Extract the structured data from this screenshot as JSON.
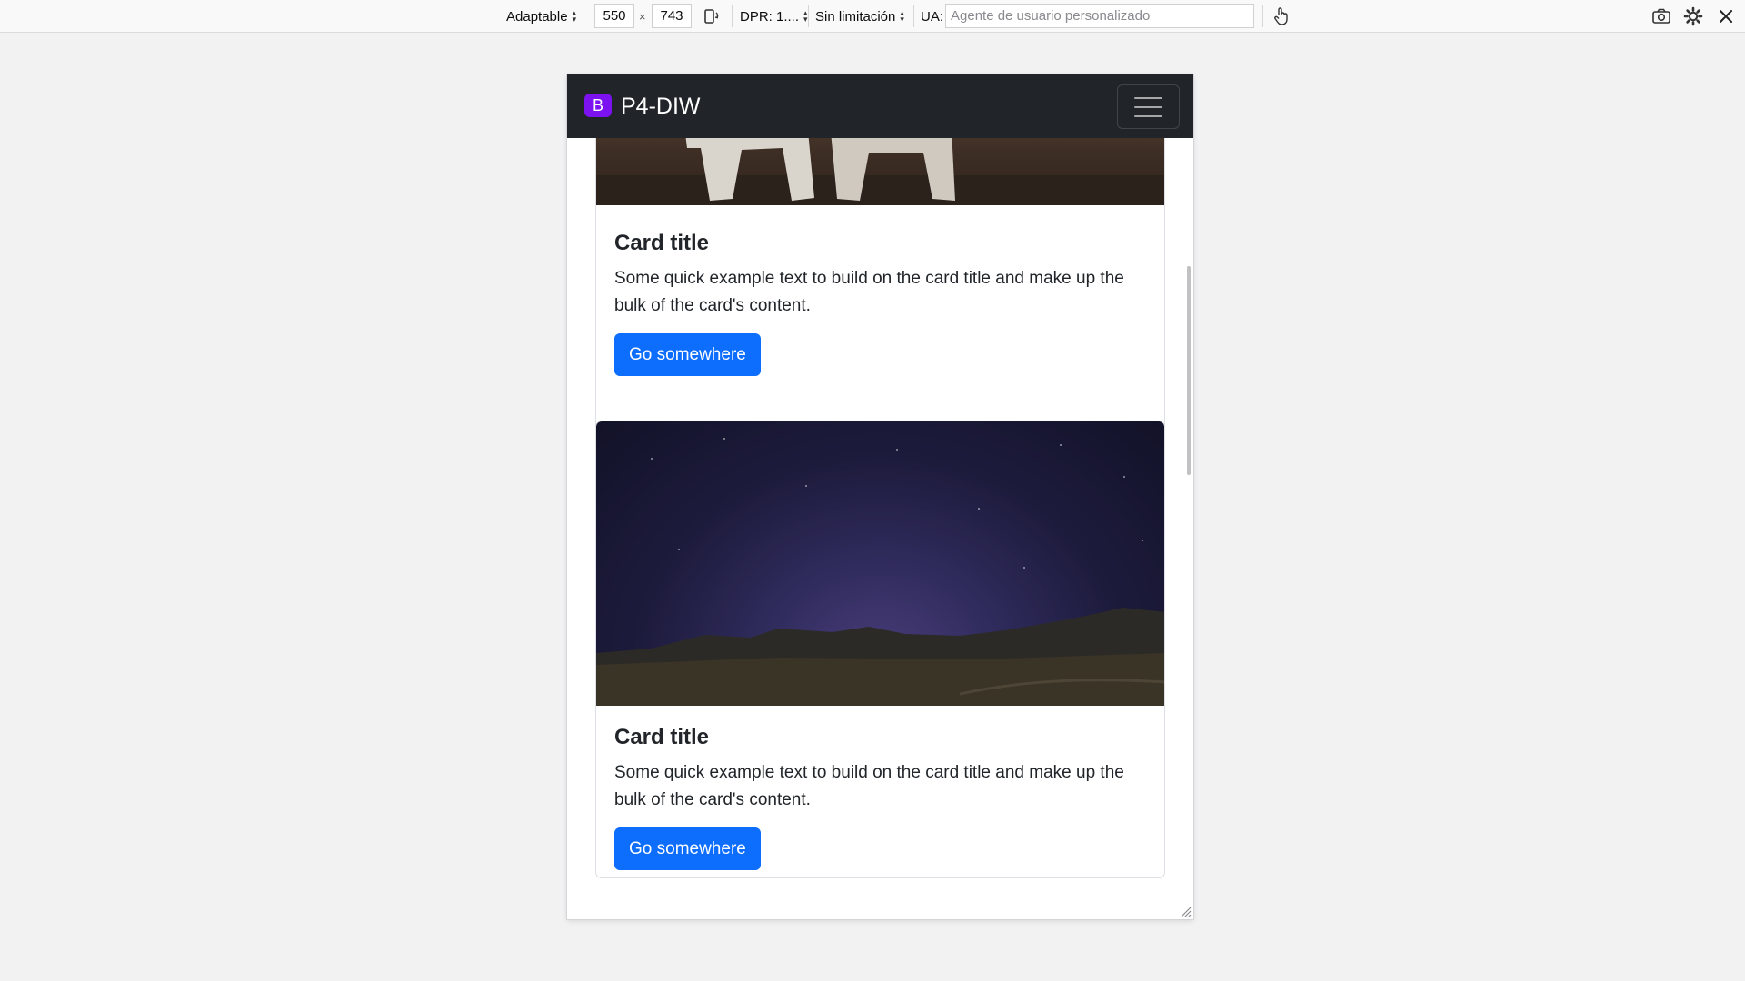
{
  "toolbar": {
    "device": "Adaptable",
    "width": "550",
    "times": "×",
    "height": "743",
    "dpr": "DPR: 1....",
    "throttling": "Sin limitación",
    "ua_label": "UA:",
    "ua_placeholder": "Agente de usuario personalizado",
    "icons": [
      "rotate-icon",
      "touch-icon",
      "screenshot-icon",
      "settings-icon",
      "close-icon"
    ]
  },
  "page": {
    "brand": {
      "logo_letter": "B",
      "title": "P4-DIW",
      "logo_color": "#7b12ef"
    },
    "cards": [
      {
        "image": "wolf-photo",
        "title": "Card title",
        "text": "Some quick example text to build on the card title and make up the bulk of the card's content.",
        "button": "Go somewhere"
      },
      {
        "image": "night-sky-photo",
        "title": "Card title",
        "text": "Some quick example text to build on the card title and make up the bulk of the card's content.",
        "button": "Go somewhere"
      }
    ]
  },
  "colors": {
    "navbar": "#212529",
    "primary_button": "#0d6efd",
    "brand": "#7b12ef"
  }
}
